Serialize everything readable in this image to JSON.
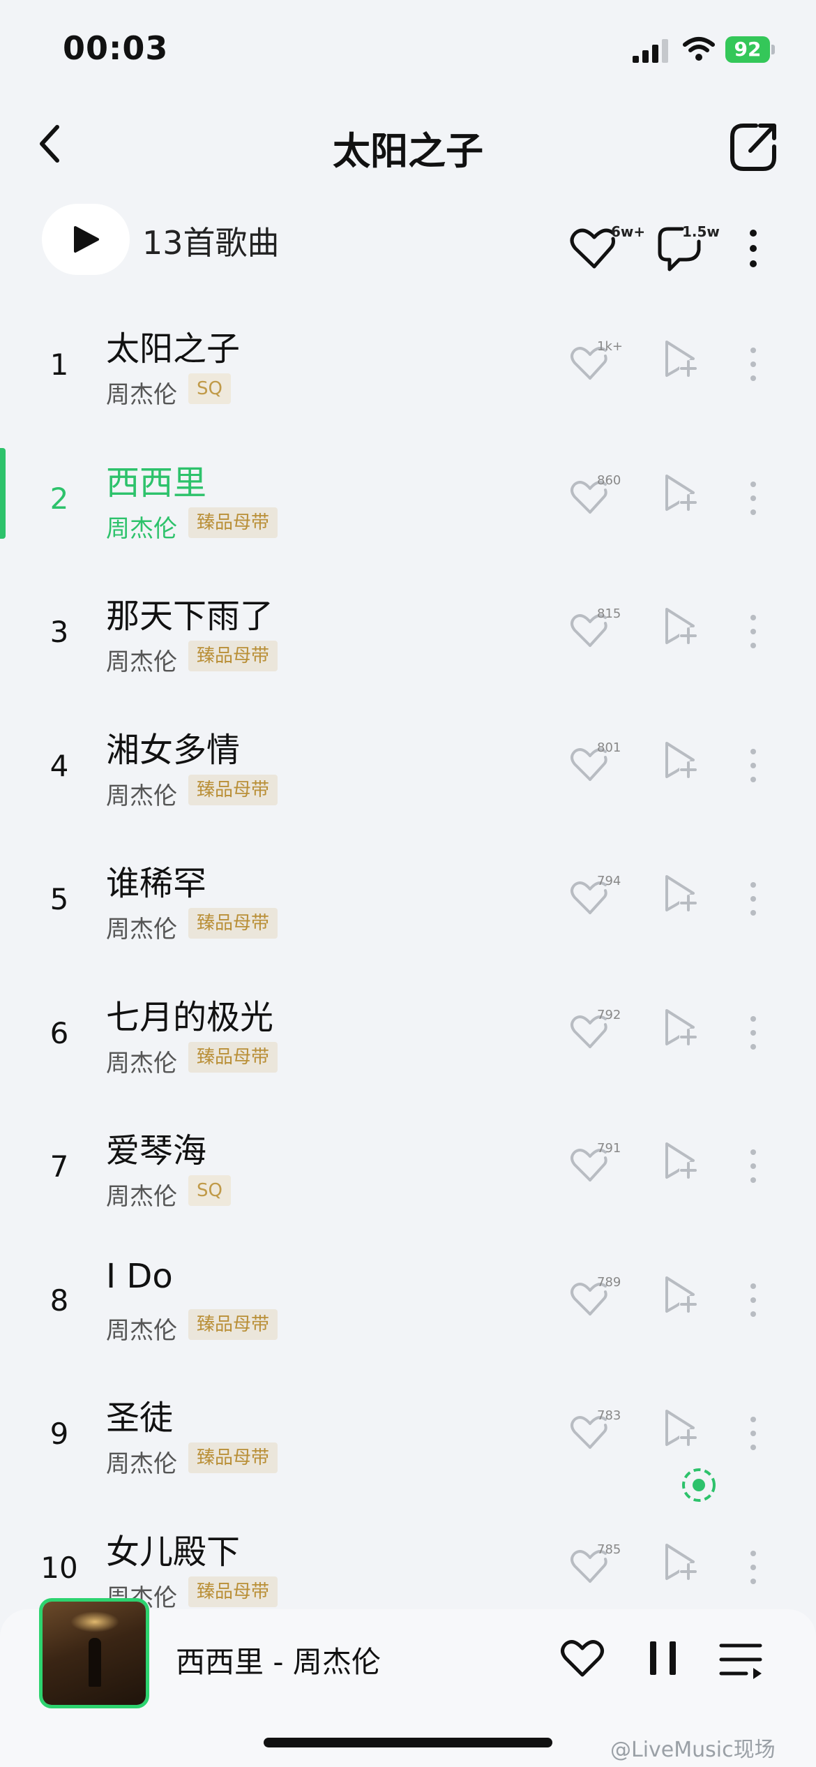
{
  "status_bar": {
    "time": "00:03",
    "battery": "92"
  },
  "header": {
    "title": "太阳之子"
  },
  "playlist": {
    "count_label": "13首歌曲",
    "like_count": "6w+",
    "comment_count": "1.5w"
  },
  "songs": [
    {
      "num": "1",
      "title": "太阳之子",
      "artist": "周杰伦",
      "badge": "SQ",
      "likes": "1k+"
    },
    {
      "num": "2",
      "title": "西西里",
      "artist": "周杰伦",
      "badge": "臻品母带",
      "likes": "860",
      "active": true
    },
    {
      "num": "3",
      "title": "那天下雨了",
      "artist": "周杰伦",
      "badge": "臻品母带",
      "likes": "815"
    },
    {
      "num": "4",
      "title": "湘女多情",
      "artist": "周杰伦",
      "badge": "臻品母带",
      "likes": "801"
    },
    {
      "num": "5",
      "title": "谁稀罕",
      "artist": "周杰伦",
      "badge": "臻品母带",
      "likes": "794"
    },
    {
      "num": "6",
      "title": "七月的极光",
      "artist": "周杰伦",
      "badge": "臻品母带",
      "likes": "792"
    },
    {
      "num": "7",
      "title": "爱琴海",
      "artist": "周杰伦",
      "badge": "SQ",
      "likes": "791"
    },
    {
      "num": "8",
      "title": "I Do",
      "artist": "周杰伦",
      "badge": "臻品母带",
      "likes": "789"
    },
    {
      "num": "9",
      "title": "圣徒",
      "artist": "周杰伦",
      "badge": "臻品母带",
      "likes": "783"
    },
    {
      "num": "10",
      "title": "女儿殿下",
      "artist": "周杰伦",
      "badge": "臻品母带",
      "likes": "785"
    }
  ],
  "now_playing": {
    "text": "西西里 - 周杰伦"
  },
  "watermark": "@LiveMusic现场",
  "colors": {
    "accent": "#2dc26b",
    "badge_text": "#b98f37",
    "background": "#f2f4f7"
  },
  "icons": [
    "back-icon",
    "share-icon",
    "play-icon",
    "heart-icon",
    "comment-icon",
    "more-icon",
    "add-to-playlist-icon",
    "locate-icon",
    "pause-icon",
    "queue-icon"
  ]
}
